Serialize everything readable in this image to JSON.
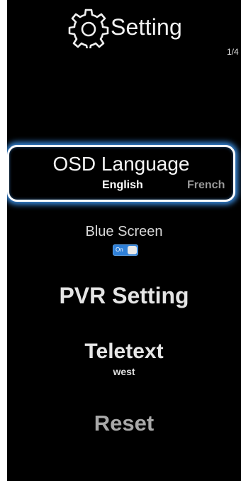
{
  "header": {
    "title": "Setting",
    "icon": "gear-icon",
    "page_indicator": "1/4"
  },
  "menu": {
    "osd_language": {
      "label": "OSD Language",
      "selected_option": "English",
      "next_option": "French"
    },
    "blue_screen": {
      "label": "Blue Screen",
      "toggle_state": "On"
    },
    "pvr_setting": {
      "label": "PVR Setting"
    },
    "teletext": {
      "label": "Teletext",
      "value": "west"
    },
    "reset": {
      "label": "Reset"
    }
  },
  "colors": {
    "background": "#000000",
    "focus_glow": "#42a0ff",
    "toggle_on": "#2f80d8",
    "text_primary": "#ffffff",
    "text_dim": "#a8a8a8"
  }
}
